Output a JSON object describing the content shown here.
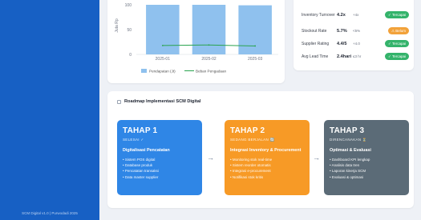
{
  "sidebar": {
    "footer": "SCM Digital v1.0 | Purwodadi 2025"
  },
  "chart": {
    "ylabel": "Juta Rp",
    "yticks": [
      "100",
      "50",
      "0"
    ],
    "categories": [
      "2025-01",
      "2025-02",
      "2025-03"
    ],
    "legend_bar": "Pendapatan (Jt)",
    "legend_line": "Beban Pengadaan",
    "colors": {
      "bar": "#8fc1ee",
      "line": "#2aa44f"
    }
  },
  "chart_data": {
    "type": "bar",
    "categories": [
      "2025-01",
      "2025-02",
      "2025-03"
    ],
    "series": [
      {
        "name": "Pendapatan (Jt)",
        "type": "bar",
        "values": [
          100,
          100,
          99
        ]
      },
      {
        "name": "Beban Pengadaan",
        "type": "line",
        "values": [
          18,
          19,
          17
        ]
      }
    ],
    "xlabel": "",
    "ylabel": "Juta Rp",
    "ylim": [
      0,
      100
    ],
    "legend": "bottom"
  },
  "kpis": [
    {
      "name": "Inventory Turnover",
      "value": "4.2x",
      "delta": "+4x",
      "status": "✓ Tercapai",
      "color": "green"
    },
    {
      "name": "Stockout Rate",
      "value": "5.7%",
      "delta": "<5%",
      "status": "⚠ Belum",
      "color": "orange"
    },
    {
      "name": "Supplier Rating",
      "value": "4.4/5",
      "delta": "+4.0",
      "status": "✓ Tercapai",
      "color": "green"
    },
    {
      "name": "Avg Lead Time",
      "value": "2.4hari",
      "delta": "≤3 hr",
      "status": "✓ Tercapai",
      "color": "green"
    }
  ],
  "roadmap": {
    "title": "Roadmap Implementasi SCM Digital",
    "stages": [
      {
        "title": "TAHAP 1",
        "status": "SELESAI ✓",
        "subtitle": "Digitalisasi Pencatatan",
        "items": [
          "Sistem POS digital",
          "Database produk",
          "Pencatatan transaksi",
          "Data master supplier"
        ]
      },
      {
        "title": "TAHAP 2",
        "status": "SEDANG BERJALAN 🔄",
        "subtitle": "Integrasi Inventory & Procurement",
        "items": [
          "Monitoring stok real-time",
          "Sistem reorder otomatis",
          "Integrasi e-procurement",
          "Notifikasi stok kritis"
        ]
      },
      {
        "title": "TAHAP 3",
        "status": "DIRENCANAKAN ⏳",
        "subtitle": "Optimasi & Evaluasi",
        "items": [
          "Dashboard KPI lengkap",
          "Analisis data tren",
          "Laporan kinerja SCM",
          "Evaluasi & optimasi"
        ]
      }
    ]
  }
}
